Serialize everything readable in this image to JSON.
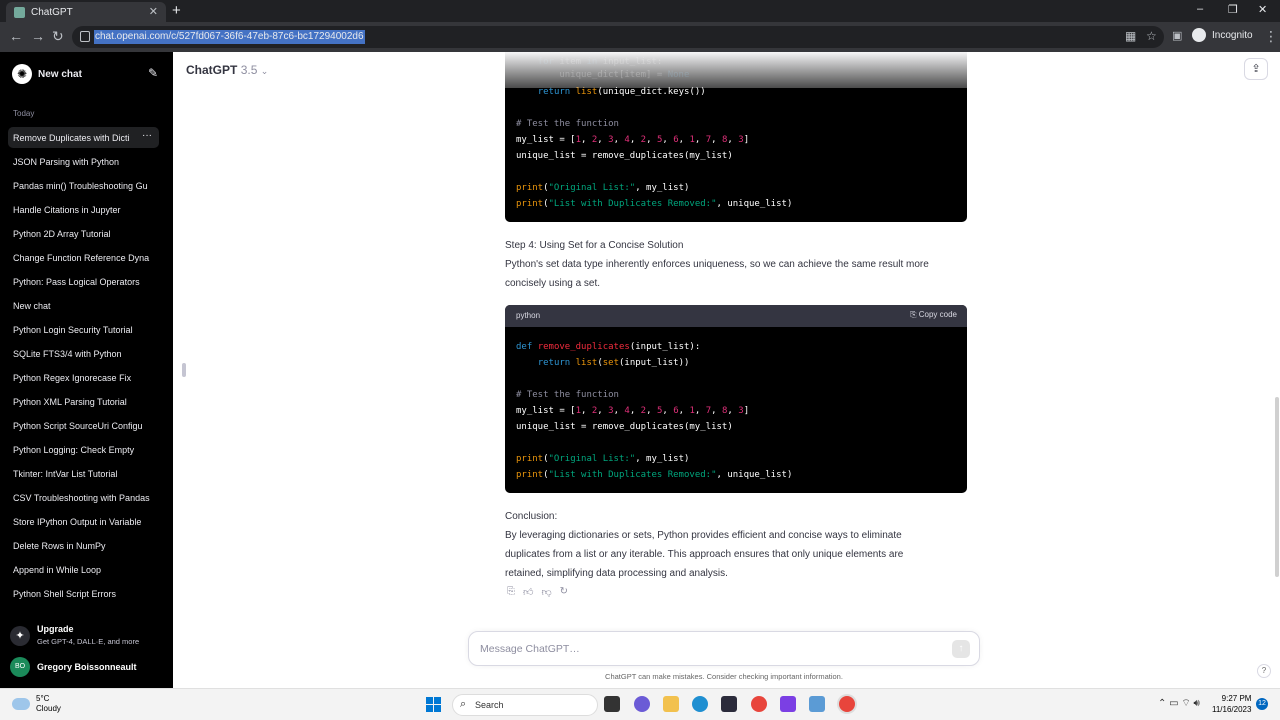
{
  "browser": {
    "tab_title": "ChatGPT",
    "tab_close": "✕",
    "new_tab": "+",
    "url": "chat.openai.com/c/527fd067-36f6-47eb-87c6-bc17294002d6",
    "profile": "Incognito",
    "win_min": "–",
    "win_max": "❐",
    "win_close": "✕"
  },
  "sidebar": {
    "new_chat": "New chat",
    "section_today": "Today",
    "items": [
      "Remove Duplicates with Dicti",
      "JSON Parsing with Python",
      "Pandas min() Troubleshooting Gu",
      "Handle Citations in Jupyter",
      "Python 2D Array Tutorial",
      "Change Function Reference Dyna",
      "Python: Pass Logical Operators",
      "New chat",
      "Python Login Security Tutorial",
      "SQLite FTS3/4 with Python",
      "Python Regex Ignorecase Fix",
      "Python XML Parsing Tutorial",
      "Python Script SourceUri Configu",
      "Python Logging: Check Empty",
      "Tkinter: IntVar List Tutorial",
      "CSV Troubleshooting with Pandas",
      "Store IPython Output in Variable",
      "Delete Rows in NumPy",
      "Append in While Loop",
      "Python Shell Script Errors"
    ],
    "active_dots": "···",
    "upgrade_title": "Upgrade",
    "upgrade_sub": "Get GPT-4, DALL·E, and more",
    "user_initials": "BO",
    "user_name": "Gregory Boissonneault"
  },
  "header": {
    "model": "ChatGPT",
    "version": "3.5"
  },
  "chat": {
    "code1_partial_line": "return list(unique_dict.keys())",
    "step4_title": "Step 4: Using Set for a Concise Solution",
    "step4_text_1": "Python's set data type inherently enforces uniqueness, so we can achieve the same result more",
    "step4_text_2": "concisely using a set.",
    "code_lang": "python",
    "copy_code": "Copy code",
    "conclusion_title": "Conclusion:",
    "conclusion_1": "By leveraging dictionaries or sets, Python provides efficient and concise ways to eliminate",
    "conclusion_2": "duplicates from a list or any iterable. This approach ensures that only unique elements are",
    "conclusion_3": "retained, simplifying data processing and analysis."
  },
  "composer": {
    "placeholder": "Message ChatGPT…",
    "disclaimer": "ChatGPT can make mistakes. Consider checking important information.",
    "help": "?"
  },
  "taskbar": {
    "temp": "5°C",
    "weather": "Cloudy",
    "search": "Search",
    "time": "9:27 PM",
    "date": "11/16/2023",
    "notifications": "12"
  }
}
